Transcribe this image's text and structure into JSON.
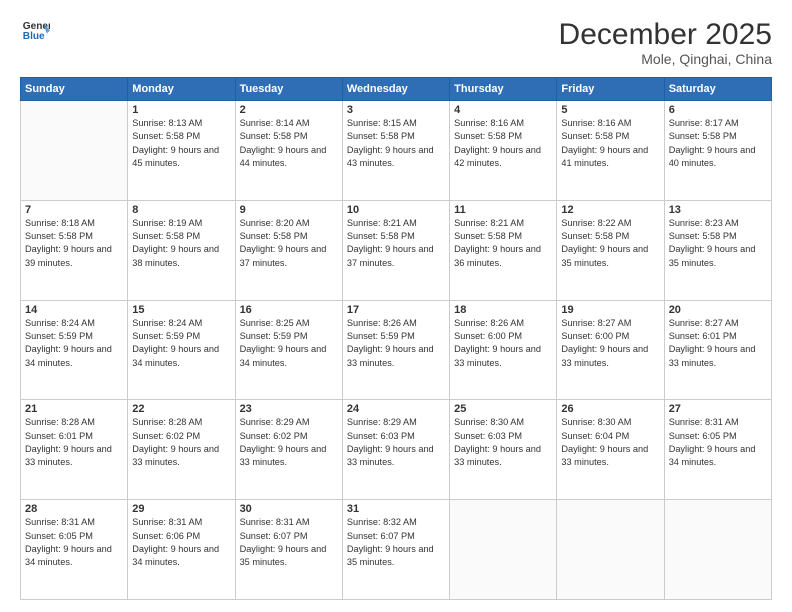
{
  "header": {
    "logo_line1": "General",
    "logo_line2": "Blue",
    "month": "December 2025",
    "location": "Mole, Qinghai, China"
  },
  "weekdays": [
    "Sunday",
    "Monday",
    "Tuesday",
    "Wednesday",
    "Thursday",
    "Friday",
    "Saturday"
  ],
  "weeks": [
    [
      {
        "day": "",
        "sunrise": "",
        "sunset": "",
        "daylight": ""
      },
      {
        "day": "1",
        "sunrise": "8:13 AM",
        "sunset": "5:58 PM",
        "daylight": "9 hours and 45 minutes."
      },
      {
        "day": "2",
        "sunrise": "8:14 AM",
        "sunset": "5:58 PM",
        "daylight": "9 hours and 44 minutes."
      },
      {
        "day": "3",
        "sunrise": "8:15 AM",
        "sunset": "5:58 PM",
        "daylight": "9 hours and 43 minutes."
      },
      {
        "day": "4",
        "sunrise": "8:16 AM",
        "sunset": "5:58 PM",
        "daylight": "9 hours and 42 minutes."
      },
      {
        "day": "5",
        "sunrise": "8:16 AM",
        "sunset": "5:58 PM",
        "daylight": "9 hours and 41 minutes."
      },
      {
        "day": "6",
        "sunrise": "8:17 AM",
        "sunset": "5:58 PM",
        "daylight": "9 hours and 40 minutes."
      }
    ],
    [
      {
        "day": "7",
        "sunrise": "8:18 AM",
        "sunset": "5:58 PM",
        "daylight": "9 hours and 39 minutes."
      },
      {
        "day": "8",
        "sunrise": "8:19 AM",
        "sunset": "5:58 PM",
        "daylight": "9 hours and 38 minutes."
      },
      {
        "day": "9",
        "sunrise": "8:20 AM",
        "sunset": "5:58 PM",
        "daylight": "9 hours and 37 minutes."
      },
      {
        "day": "10",
        "sunrise": "8:21 AM",
        "sunset": "5:58 PM",
        "daylight": "9 hours and 37 minutes."
      },
      {
        "day": "11",
        "sunrise": "8:21 AM",
        "sunset": "5:58 PM",
        "daylight": "9 hours and 36 minutes."
      },
      {
        "day": "12",
        "sunrise": "8:22 AM",
        "sunset": "5:58 PM",
        "daylight": "9 hours and 35 minutes."
      },
      {
        "day": "13",
        "sunrise": "8:23 AM",
        "sunset": "5:58 PM",
        "daylight": "9 hours and 35 minutes."
      }
    ],
    [
      {
        "day": "14",
        "sunrise": "8:24 AM",
        "sunset": "5:59 PM",
        "daylight": "9 hours and 34 minutes."
      },
      {
        "day": "15",
        "sunrise": "8:24 AM",
        "sunset": "5:59 PM",
        "daylight": "9 hours and 34 minutes."
      },
      {
        "day": "16",
        "sunrise": "8:25 AM",
        "sunset": "5:59 PM",
        "daylight": "9 hours and 34 minutes."
      },
      {
        "day": "17",
        "sunrise": "8:26 AM",
        "sunset": "5:59 PM",
        "daylight": "9 hours and 33 minutes."
      },
      {
        "day": "18",
        "sunrise": "8:26 AM",
        "sunset": "6:00 PM",
        "daylight": "9 hours and 33 minutes."
      },
      {
        "day": "19",
        "sunrise": "8:27 AM",
        "sunset": "6:00 PM",
        "daylight": "9 hours and 33 minutes."
      },
      {
        "day": "20",
        "sunrise": "8:27 AM",
        "sunset": "6:01 PM",
        "daylight": "9 hours and 33 minutes."
      }
    ],
    [
      {
        "day": "21",
        "sunrise": "8:28 AM",
        "sunset": "6:01 PM",
        "daylight": "9 hours and 33 minutes."
      },
      {
        "day": "22",
        "sunrise": "8:28 AM",
        "sunset": "6:02 PM",
        "daylight": "9 hours and 33 minutes."
      },
      {
        "day": "23",
        "sunrise": "8:29 AM",
        "sunset": "6:02 PM",
        "daylight": "9 hours and 33 minutes."
      },
      {
        "day": "24",
        "sunrise": "8:29 AM",
        "sunset": "6:03 PM",
        "daylight": "9 hours and 33 minutes."
      },
      {
        "day": "25",
        "sunrise": "8:30 AM",
        "sunset": "6:03 PM",
        "daylight": "9 hours and 33 minutes."
      },
      {
        "day": "26",
        "sunrise": "8:30 AM",
        "sunset": "6:04 PM",
        "daylight": "9 hours and 33 minutes."
      },
      {
        "day": "27",
        "sunrise": "8:31 AM",
        "sunset": "6:05 PM",
        "daylight": "9 hours and 34 minutes."
      }
    ],
    [
      {
        "day": "28",
        "sunrise": "8:31 AM",
        "sunset": "6:05 PM",
        "daylight": "9 hours and 34 minutes."
      },
      {
        "day": "29",
        "sunrise": "8:31 AM",
        "sunset": "6:06 PM",
        "daylight": "9 hours and 34 minutes."
      },
      {
        "day": "30",
        "sunrise": "8:31 AM",
        "sunset": "6:07 PM",
        "daylight": "9 hours and 35 minutes."
      },
      {
        "day": "31",
        "sunrise": "8:32 AM",
        "sunset": "6:07 PM",
        "daylight": "9 hours and 35 minutes."
      },
      {
        "day": "",
        "sunrise": "",
        "sunset": "",
        "daylight": ""
      },
      {
        "day": "",
        "sunrise": "",
        "sunset": "",
        "daylight": ""
      },
      {
        "day": "",
        "sunrise": "",
        "sunset": "",
        "daylight": ""
      }
    ]
  ]
}
